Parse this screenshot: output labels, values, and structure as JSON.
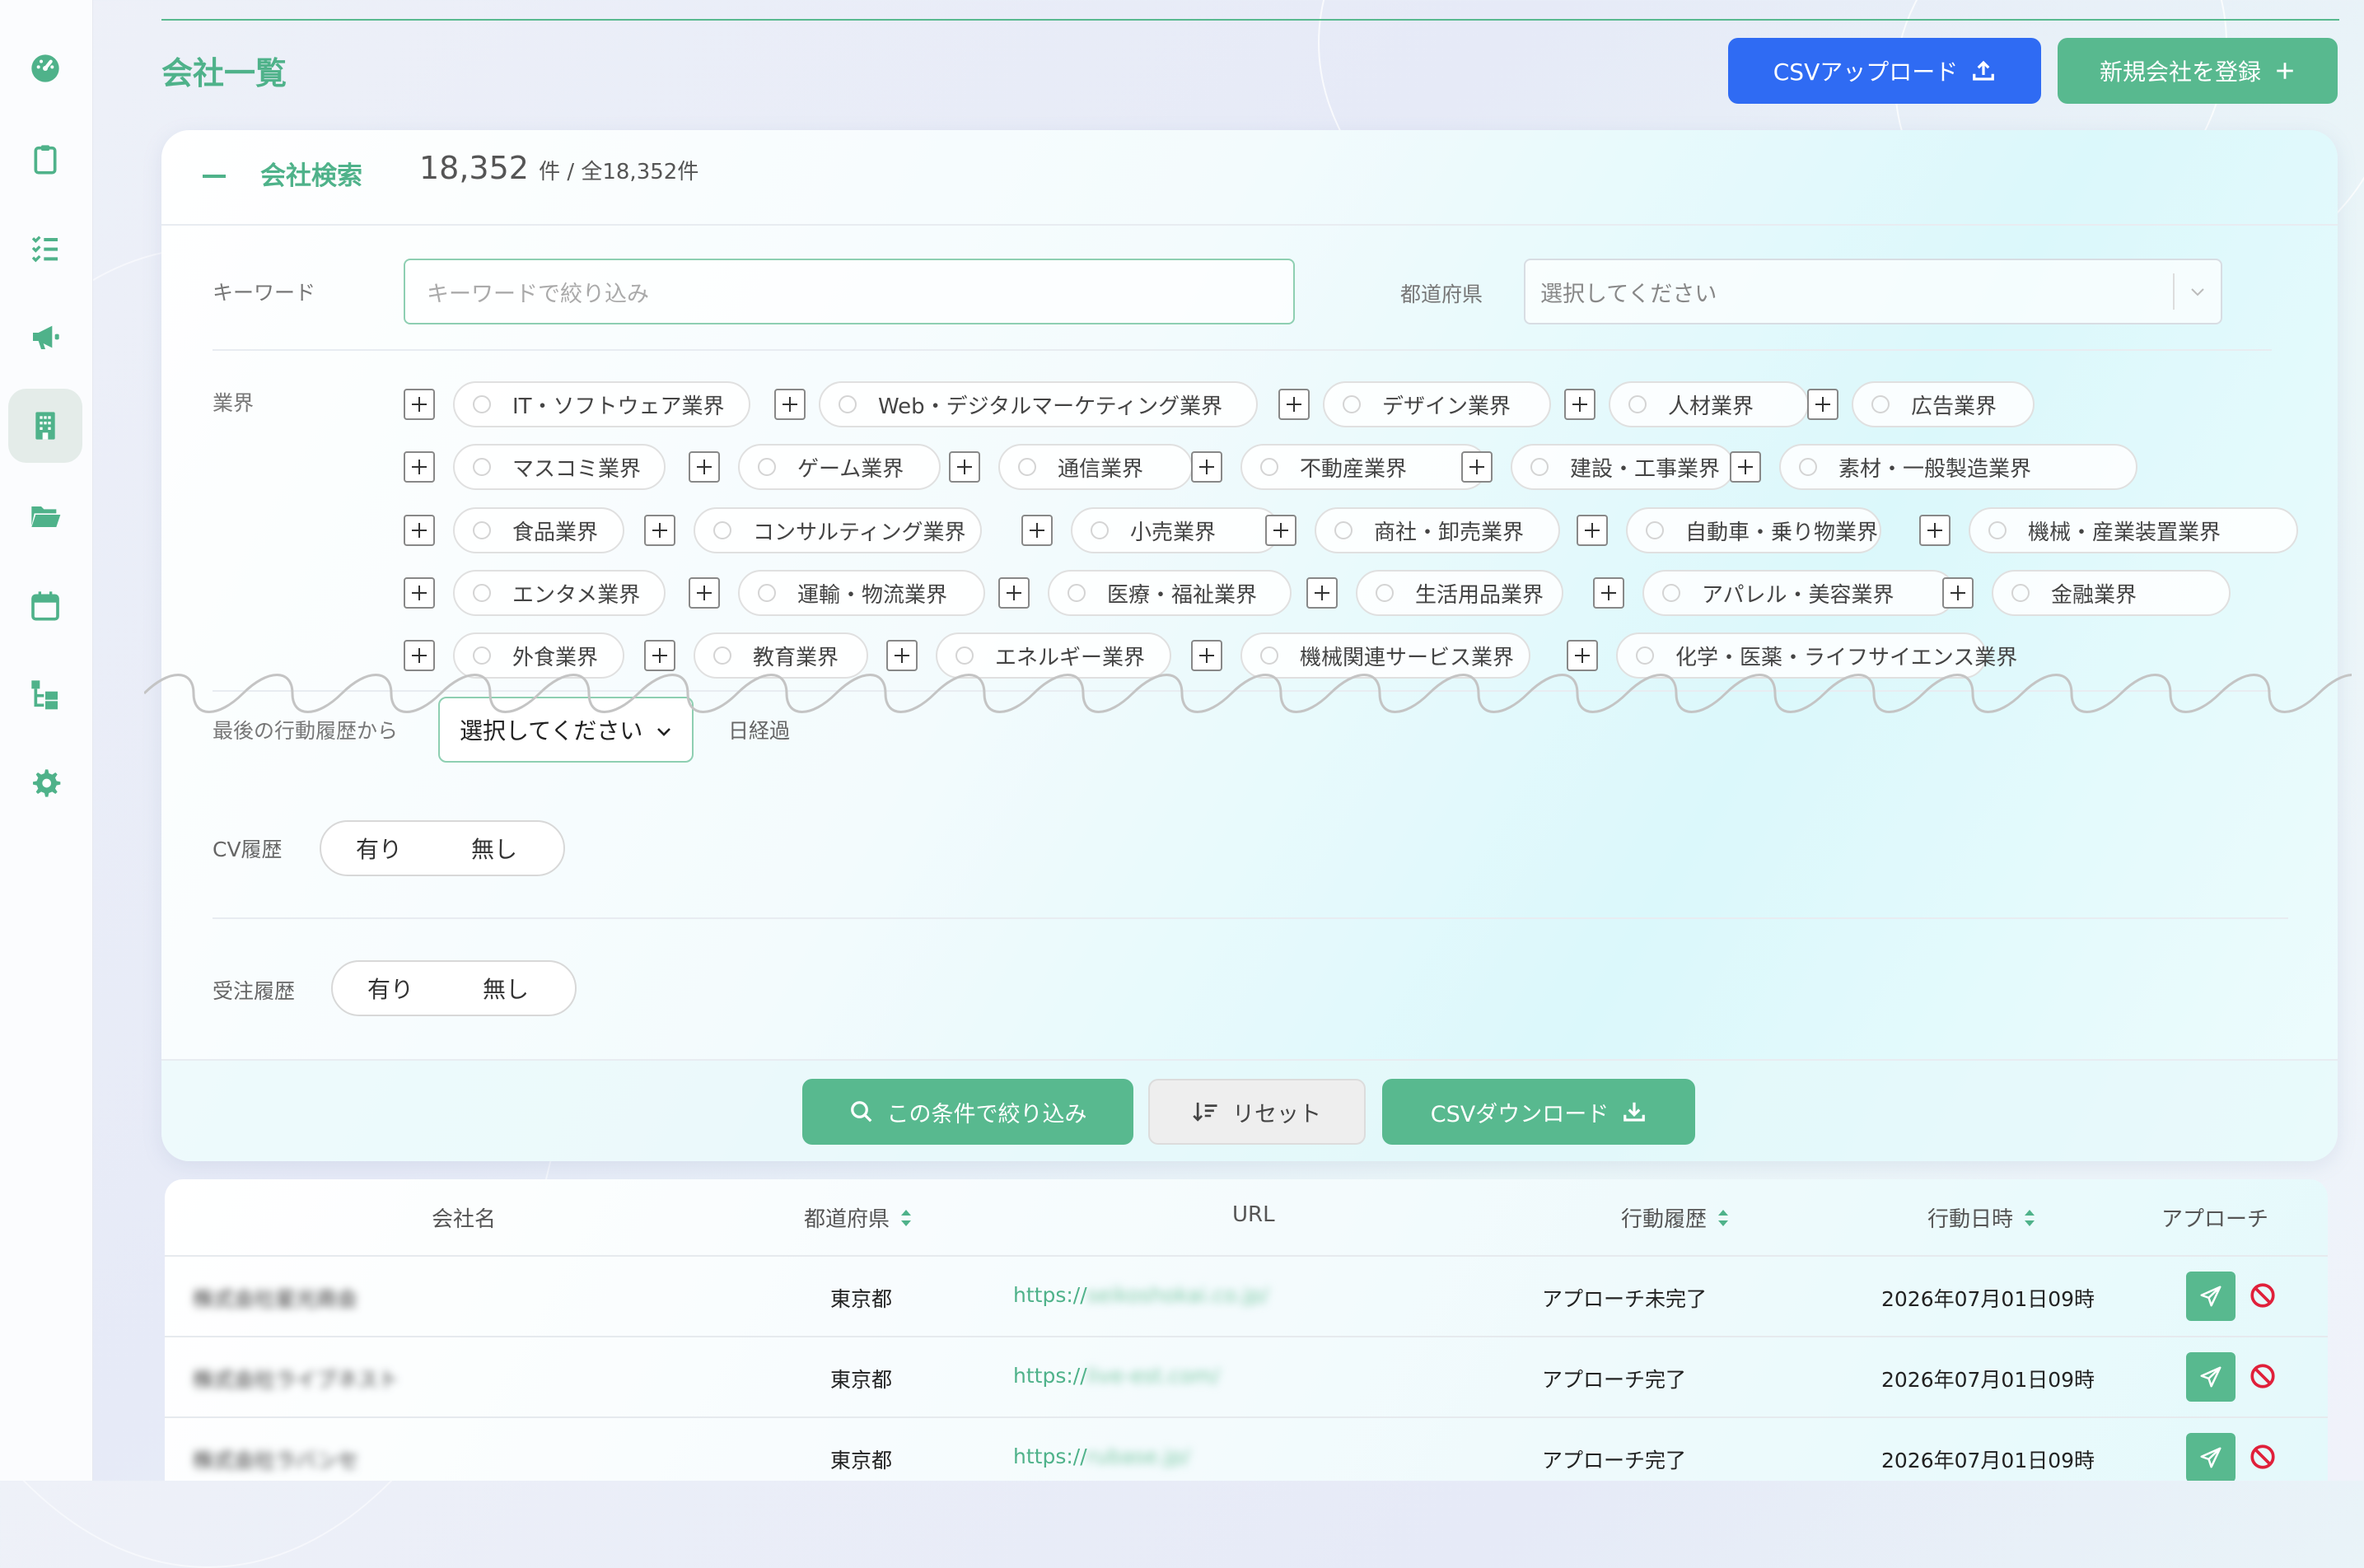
{
  "page": {
    "title": "会社一覧",
    "csv_upload_label": "CSVアップロード",
    "new_company_label": "新規会社を登録"
  },
  "search": {
    "title": "会社検索",
    "count": "18,352",
    "count_unit": "件 / 全18,352件",
    "keyword_label": "キーワード",
    "keyword_placeholder": "キーワードで絞り込み",
    "prefecture_label": "都道府県",
    "prefecture_placeholder": "選択してください",
    "industry_label": "業界",
    "industries": [
      "IT・ソフトウェア業界",
      "Web・デジタルマーケティング業界",
      "デザイン業界",
      "人材業界",
      "広告業界",
      "マスコミ業界",
      "ゲーム業界",
      "通信業界",
      "不動産業界",
      "建設・工事業界",
      "素材・一般製造業界",
      "食品業界",
      "コンサルティング業界",
      "小売業界",
      "商社・卸売業界",
      "自動車・乗り物業界",
      "機械・産業装置業界",
      "エンタメ業界",
      "運輸・物流業界",
      "医療・福祉業界",
      "生活用品業界",
      "アパレル・美容業界",
      "金融業界",
      "外食業界",
      "教育業界",
      "エネルギー業界",
      "機械関連サービス業界",
      "化学・医薬・ライフサイエンス業界"
    ],
    "last_action_label": "最後の行動履歴から",
    "last_action_value": "選択してください",
    "last_action_suffix": "日経過",
    "cv_label": "CV履歴",
    "order_label": "受注履歴",
    "yes": "有り",
    "no": "無し",
    "filter_button": "この条件で絞り込み",
    "reset_button": "リセット",
    "csv_download_button": "CSVダウンロード"
  },
  "table": {
    "headers": {
      "company": "会社名",
      "prefecture": "都道府県",
      "url": "URL",
      "action_history": "行動履歴",
      "action_date": "行動日時",
      "approach": "アプローチ"
    },
    "rows": [
      {
        "company": "株式会社星光商会",
        "prefecture": "東京都",
        "url_prefix": "https://",
        "url_rest": "seikoshokai.co.jp/",
        "status": "アプローチ未完了",
        "datetime": "2026年07月01日09時"
      },
      {
        "company": "株式会社ライブネスト",
        "prefecture": "東京都",
        "url_prefix": "https://",
        "url_rest": "live-est.com/",
        "status": "アプローチ完了",
        "datetime": "2026年07月01日09時"
      },
      {
        "company": "株式会社ラバンセ",
        "prefecture": "東京都",
        "url_prefix": "https://",
        "url_rest": "rubase.jp/",
        "status": "アプローチ完了",
        "datetime": "2026年07月01日09時"
      }
    ]
  },
  "colors": {
    "accent": "#4fb28a",
    "primary_blue": "#2f6bf3",
    "danger": "#e0203a"
  },
  "icons": [
    "dashboard-icon",
    "clipboard-icon",
    "checklist-icon",
    "megaphone-icon",
    "building-icon",
    "folder-icon",
    "calendar-icon",
    "hierarchy-icon",
    "gear-icon"
  ]
}
